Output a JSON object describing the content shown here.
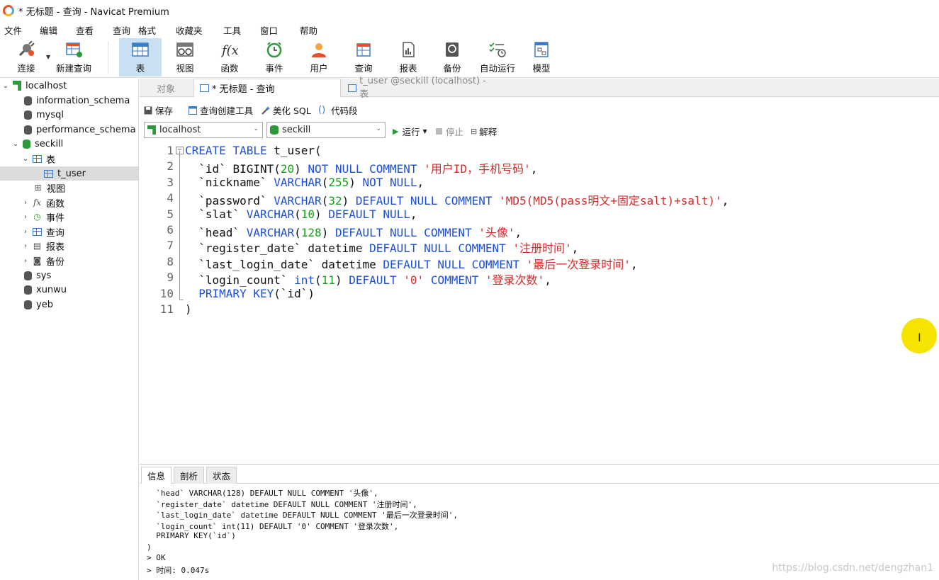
{
  "window": {
    "title": "* 无标题 - 查询 - Navicat Premium"
  },
  "menu": [
    "文件",
    "编辑",
    "查看",
    "查询",
    "格式",
    "收藏夹",
    "工具",
    "窗口",
    "帮助"
  ],
  "toolbar": {
    "connect": "连接",
    "new_query": "新建查询",
    "table": "表",
    "view": "视图",
    "function": "函数",
    "event": "事件",
    "user": "用户",
    "query": "查询",
    "report": "报表",
    "backup": "备份",
    "automation": "自动运行",
    "model": "模型"
  },
  "nav": {
    "server": "localhost",
    "databases": [
      "information_schema",
      "mysql",
      "performance_schema",
      "seckill"
    ],
    "seckill_children": {
      "tables": "表",
      "table_item": "t_user",
      "views": "视图",
      "functions": "函数",
      "events": "事件",
      "queries": "查询",
      "reports": "报表",
      "backups": "备份"
    },
    "other_dbs": [
      "sys",
      "xunwu",
      "yeb"
    ]
  },
  "tabs": {
    "objects": "对象",
    "query": "* 无标题 - 查询",
    "table": "t_user @seckill (localhost) - 表"
  },
  "query_toolbar": {
    "save": "保存",
    "builder": "查询创建工具",
    "beautify": "美化 SQL",
    "snippet": "代码段"
  },
  "selectors": {
    "connection": "localhost",
    "database": "seckill",
    "run": "运行",
    "stop": "停止",
    "explain": "解释"
  },
  "editor": {
    "line_numbers": [
      "1",
      "2",
      "3",
      "4",
      "5",
      "6",
      "7",
      "8",
      "9",
      "10",
      "11"
    ],
    "lines": [
      [
        {
          "t": "CREATE TABLE",
          "c": "kw"
        },
        {
          "t": " t_user(",
          "c": ""
        }
      ],
      [
        {
          "t": "  `id` ",
          "c": ""
        },
        {
          "t": "BIGINT",
          "c": ""
        },
        {
          "t": "(",
          "c": ""
        },
        {
          "t": "20",
          "c": "num"
        },
        {
          "t": ") ",
          "c": ""
        },
        {
          "t": "NOT NULL COMMENT",
          "c": "kw"
        },
        {
          "t": " ",
          "c": ""
        },
        {
          "t": "'用户ID，手机号码'",
          "c": "str"
        },
        {
          "t": ",",
          "c": ""
        }
      ],
      [
        {
          "t": "  `nickname` ",
          "c": ""
        },
        {
          "t": "VARCHAR",
          "c": "kw"
        },
        {
          "t": "(",
          "c": ""
        },
        {
          "t": "255",
          "c": "num"
        },
        {
          "t": ") ",
          "c": ""
        },
        {
          "t": "NOT NULL",
          "c": "kw"
        },
        {
          "t": ",",
          "c": ""
        }
      ],
      [
        {
          "t": "  `password` ",
          "c": ""
        },
        {
          "t": "VARCHAR",
          "c": "kw"
        },
        {
          "t": "(",
          "c": ""
        },
        {
          "t": "32",
          "c": "num"
        },
        {
          "t": ") ",
          "c": ""
        },
        {
          "t": "DEFAULT NULL COMMENT",
          "c": "kw"
        },
        {
          "t": " ",
          "c": ""
        },
        {
          "t": "'MD5(MD5(pass明文+固定salt)+salt)'",
          "c": "str"
        },
        {
          "t": ",",
          "c": ""
        }
      ],
      [
        {
          "t": "  `slat` ",
          "c": ""
        },
        {
          "t": "VARCHAR",
          "c": "kw"
        },
        {
          "t": "(",
          "c": ""
        },
        {
          "t": "10",
          "c": "num"
        },
        {
          "t": ") ",
          "c": ""
        },
        {
          "t": "DEFAULT NULL",
          "c": "kw"
        },
        {
          "t": ",",
          "c": ""
        }
      ],
      [
        {
          "t": "  `head` ",
          "c": ""
        },
        {
          "t": "VARCHAR",
          "c": "kw"
        },
        {
          "t": "(",
          "c": ""
        },
        {
          "t": "128",
          "c": "num"
        },
        {
          "t": ") ",
          "c": ""
        },
        {
          "t": "DEFAULT NULL COMMENT",
          "c": "kw"
        },
        {
          "t": " ",
          "c": ""
        },
        {
          "t": "'头像'",
          "c": "str"
        },
        {
          "t": ",",
          "c": ""
        }
      ],
      [
        {
          "t": "  `register_date` datetime ",
          "c": ""
        },
        {
          "t": "DEFAULT NULL COMMENT",
          "c": "kw"
        },
        {
          "t": " ",
          "c": ""
        },
        {
          "t": "'注册时间'",
          "c": "str"
        },
        {
          "t": ",",
          "c": ""
        }
      ],
      [
        {
          "t": "  `last_login_date` datetime ",
          "c": ""
        },
        {
          "t": "DEFAULT NULL COMMENT",
          "c": "kw"
        },
        {
          "t": " ",
          "c": ""
        },
        {
          "t": "'最后一次登录时间'",
          "c": "str"
        },
        {
          "t": ",",
          "c": ""
        }
      ],
      [
        {
          "t": "  `login_count` ",
          "c": ""
        },
        {
          "t": "int",
          "c": "kw"
        },
        {
          "t": "(",
          "c": ""
        },
        {
          "t": "11",
          "c": "num"
        },
        {
          "t": ") ",
          "c": ""
        },
        {
          "t": "DEFAULT",
          "c": "kw"
        },
        {
          "t": " ",
          "c": ""
        },
        {
          "t": "'0'",
          "c": "str"
        },
        {
          "t": " ",
          "c": ""
        },
        {
          "t": "COMMENT",
          "c": "kw"
        },
        {
          "t": " ",
          "c": ""
        },
        {
          "t": "'登录次数'",
          "c": "str"
        },
        {
          "t": ",",
          "c": ""
        }
      ],
      [
        {
          "t": "  ",
          "c": ""
        },
        {
          "t": "PRIMARY KEY",
          "c": "kw"
        },
        {
          "t": "(`id`)",
          "c": ""
        }
      ],
      [
        {
          "t": ")",
          "c": ""
        }
      ]
    ]
  },
  "bottom": {
    "tabs": [
      "信息",
      "剖析",
      "状态"
    ],
    "messages": [
      "  `head` VARCHAR(128) DEFAULT NULL COMMENT '头像',",
      "  `register_date` datetime DEFAULT NULL COMMENT '注册时间',",
      "  `last_login_date` datetime DEFAULT NULL COMMENT '最后一次登录时间',",
      "  `login_count` int(11) DEFAULT '0' COMMENT '登录次数',",
      "  PRIMARY KEY(`id`)",
      ")",
      "> OK",
      "> 时间: 0.047s"
    ]
  },
  "watermark": "https://blog.csdn.net/dengzhan1",
  "colors": {
    "keyword": "#1b4fd8",
    "number": "#14a014",
    "string": "#d42a2a",
    "active_button": "#c9dff2"
  }
}
